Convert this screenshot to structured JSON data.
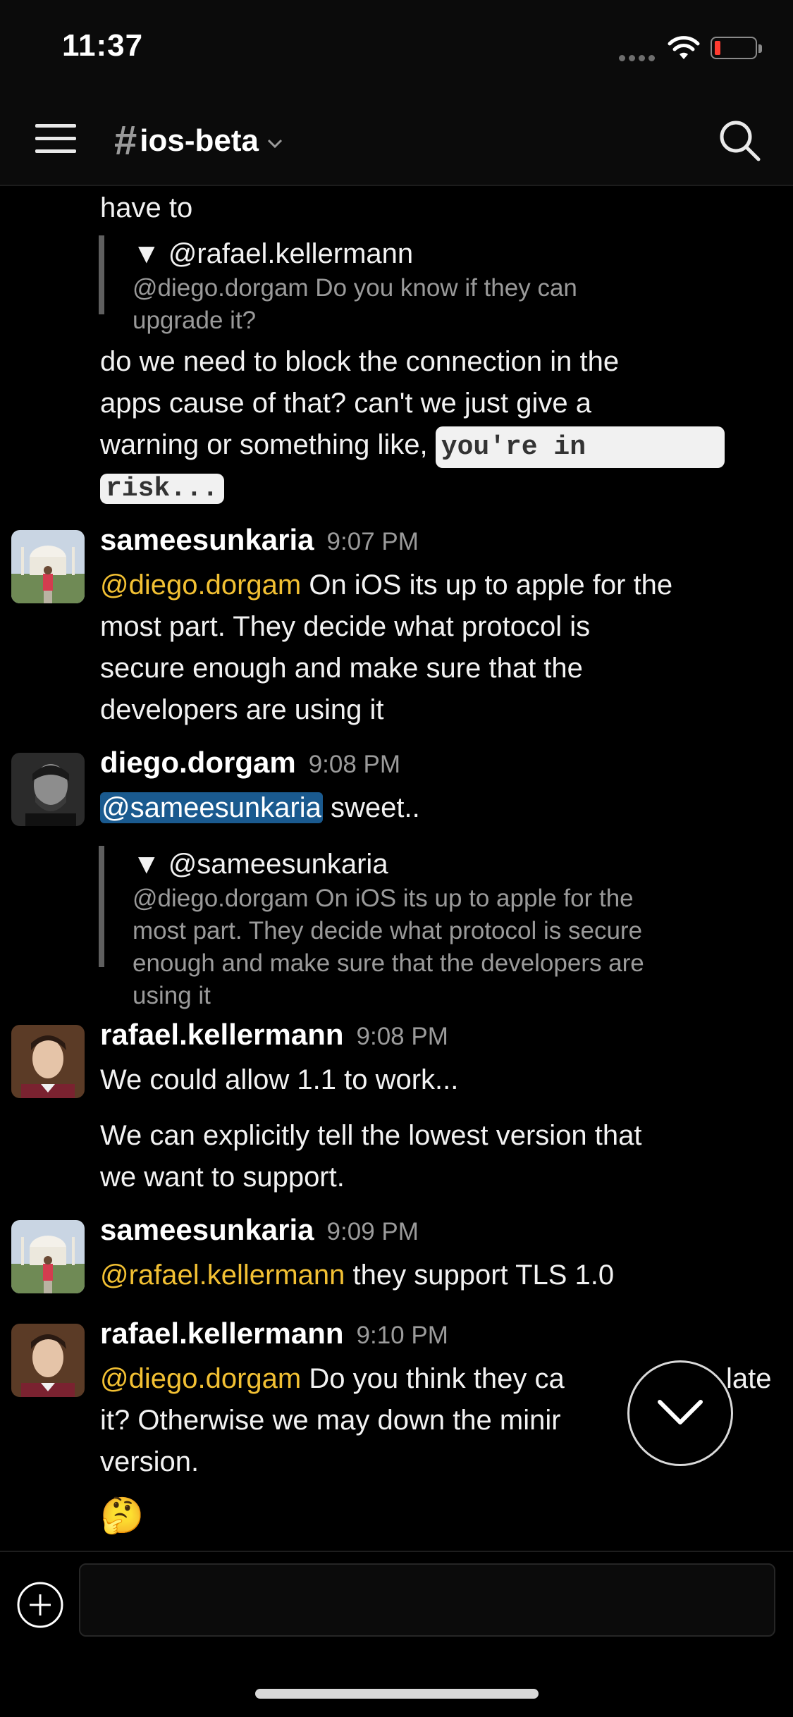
{
  "status_bar": {
    "time": "11:37"
  },
  "header": {
    "hash": "#",
    "channel_name": "ios-beta"
  },
  "messages": {
    "m0": {
      "line1": "have to",
      "quote_title": "▼ @rafael.kellermann",
      "quote_body": "@diego.dorgam Do you know if they can upgrade it?",
      "line2": "do we need to block the connection in the",
      "line3": "apps cause of that? can't we just give a",
      "line4_text": "warning or something like, ",
      "line4_code": "you're in ",
      "line5_code": "risk..."
    },
    "m1": {
      "author": "sameesunkaria",
      "time": "9:07 PM",
      "mention": "@diego.dorgam",
      "l1": " On iOS its up to apple for the",
      "l2": "most part. They decide what protocol is",
      "l3": "secure enough and make sure that the",
      "l4": "developers are using it"
    },
    "m2": {
      "author": "diego.dorgam",
      "time": "9:08 PM",
      "mention": "@sameesunkaria",
      "text": " sweet..",
      "quote_title": "▼ @sameesunkaria",
      "quote_l1": "@diego.dorgam On iOS its up to apple for the",
      "quote_l2": "most part. They decide what protocol is secure",
      "quote_l3": "enough and make sure that the developers are",
      "quote_l4": "using it"
    },
    "m3": {
      "author": "rafael.kellermann",
      "time": "9:08 PM",
      "l1": "We could allow 1.1 to work...",
      "l2": "We can explicitly tell the lowest version that",
      "l3": "we want to support."
    },
    "m4": {
      "author": "sameesunkaria",
      "time": "9:09 PM",
      "mention": "@rafael.kellermann",
      "text": " they support TLS 1.0"
    },
    "m5": {
      "author": "rafael.kellermann",
      "time": "9:10 PM",
      "mention": "@diego.dorgam",
      "l1": " Do you think they ca",
      "l1_end": "late",
      "l2": "it? Otherwise we may down the minir",
      "l3": "version.",
      "emoji": "🤔"
    }
  },
  "composer": {
    "placeholder": ""
  },
  "colors": {
    "mention": "#f2c033",
    "mention_highlight": "#1a5a8f",
    "background": "#000000"
  }
}
